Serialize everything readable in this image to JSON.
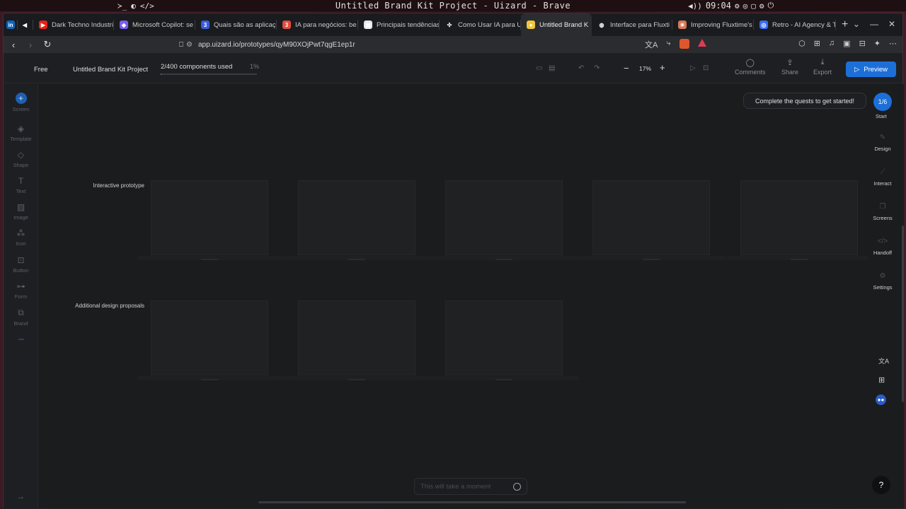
{
  "os": {
    "left_glyphs": [
      "≻_",
      "◐",
      "</>"
    ],
    "title": "Untitled Brand Kit Project - Uizard - Brave",
    "clock": "09:04",
    "right_glyphs": [
      "◀))",
      "⚙",
      "◎",
      "▢",
      "⚙",
      "⏻"
    ]
  },
  "tabs": [
    {
      "label": "",
      "icon": "linkedin-icon",
      "color": "#0a66c2",
      "glyph": "in"
    },
    {
      "label": "",
      "icon": "speaker-icon",
      "color": "#1a1b1e",
      "glyph": "◀"
    },
    {
      "label": "Dark Techno Industri",
      "icon": "youtube-icon",
      "color": "#e62117",
      "glyph": "▶"
    },
    {
      "label": "Microsoft Copilot: se",
      "icon": "copilot-icon",
      "color": "#7a5cf0",
      "glyph": "◆"
    },
    {
      "label": "Quais são as aplicaç",
      "icon": "gemini-icon",
      "color": "#3b5bdb",
      "glyph": "3"
    },
    {
      "label": "IA para negócios: be",
      "icon": "red-circle-icon",
      "color": "#e24a3b",
      "glyph": "3"
    },
    {
      "label": "Principais tendências",
      "icon": "bookmark-icon",
      "color": "#e8e8e8",
      "glyph": "▣"
    },
    {
      "label": "Como Usar IA para U",
      "icon": "nodes-icon",
      "color": "#1a1b1e",
      "glyph": "✣"
    },
    {
      "label": "Untitled Brand K",
      "icon": "uizard-icon",
      "color": "#f2c63a",
      "glyph": "●",
      "active": true
    },
    {
      "label": "Interface para Fluxti",
      "icon": "globe-icon",
      "color": "#1a1b1e",
      "glyph": "◍"
    },
    {
      "label": "Improving Fluxtime's",
      "icon": "claude-icon",
      "color": "#d97757",
      "glyph": "✳"
    },
    {
      "label": "Retro - AI Agency & T",
      "icon": "retro-icon",
      "color": "#3b6cf0",
      "glyph": "◎"
    }
  ],
  "new_tab": "+",
  "tab_controls": [
    "⌄",
    "—",
    "✕"
  ],
  "close_glyph": "✕",
  "nav": {
    "back": "‹",
    "forward": "›",
    "reload": "↻"
  },
  "url": "app.uizard.io/prototypes/qyM90XOjPwt7qgE1ep1r",
  "url_icons": [
    "文A",
    "⤷"
  ],
  "ext_icons": [
    "⬡",
    "⊞",
    "♫",
    "▣",
    "⊟",
    "✦",
    "⋯"
  ],
  "app": {
    "plan": "Free",
    "project_name": "Untitled Brand Kit Project",
    "usage": "2/400 components used",
    "usage_pct": "1%",
    "usage_fraction": 0.01,
    "zoom": "17%",
    "zoom_minus": "−",
    "zoom_plus": "+",
    "device_glyphs": [
      "▭",
      "▤"
    ],
    "history_glyphs": [
      "↶",
      "↷"
    ],
    "play_glyphs": [
      "▷",
      "⊡"
    ],
    "actions": [
      {
        "label": "Comments",
        "glyph": "◯"
      },
      {
        "label": "Share",
        "glyph": "⇪"
      },
      {
        "label": "Export",
        "glyph": "⤓"
      }
    ],
    "preview": "Preview",
    "preview_glyph": "▷"
  },
  "left_sidebar": [
    {
      "label": "Screen",
      "glyph": "+"
    },
    {
      "label": "Template",
      "glyph": "◈"
    },
    {
      "label": "Shape",
      "glyph": "◇"
    },
    {
      "label": "Text",
      "glyph": "T"
    },
    {
      "label": "Image",
      "glyph": "▨"
    },
    {
      "label": "Icon",
      "glyph": "⁂"
    },
    {
      "label": "Button",
      "glyph": "⊡"
    },
    {
      "label": "Form",
      "glyph": "⊶"
    },
    {
      "label": "Brand",
      "glyph": "⧉"
    }
  ],
  "left_sidebar_bottom_glyph": "→",
  "canvas": {
    "row1_label": "Interactive prototype",
    "row2_label": "Additional design proposals",
    "quest_text": "Complete the quests to get started!",
    "moment_placeholder": "This will take a moment"
  },
  "right_rail": {
    "start_counter": "1/6",
    "start_label": "Start",
    "items": [
      {
        "label": "Design",
        "glyph": "✎"
      },
      {
        "label": "Interact",
        "glyph": "⟋"
      },
      {
        "label": "Screens",
        "glyph": "❐"
      },
      {
        "label": "Handoff",
        "glyph": "</>"
      },
      {
        "label": "Settings",
        "glyph": "⚙"
      }
    ],
    "translate_glyph": "文A",
    "grid_glyph": "⊞",
    "bot_glyph": "●●",
    "help": "?"
  }
}
